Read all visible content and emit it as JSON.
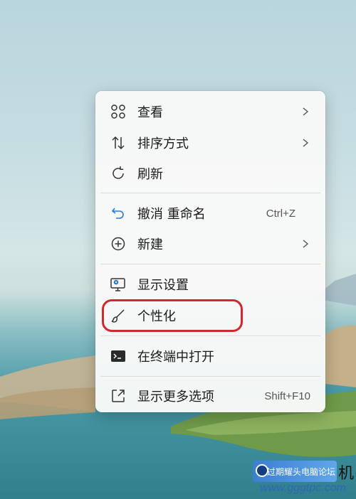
{
  "context_menu": {
    "items": [
      {
        "label": "查看",
        "icon": "grid-icon",
        "submenu": true
      },
      {
        "label": "排序方式",
        "icon": "sort-icon",
        "submenu": true
      },
      {
        "label": "刷新",
        "icon": "refresh-icon"
      },
      {
        "label": "撤消 重命名",
        "icon": "undo-icon",
        "shortcut": "Ctrl+Z"
      },
      {
        "label": "新建",
        "icon": "plus-circle-icon",
        "submenu": true
      },
      {
        "label": "显示设置",
        "icon": "display-settings-icon"
      },
      {
        "label": "个性化",
        "icon": "brush-icon",
        "highlighted": true
      },
      {
        "label": "在终端中打开",
        "icon": "terminal-icon"
      },
      {
        "label": "显示更多选项",
        "icon": "more-options-icon",
        "shortcut": "Shift+F10"
      }
    ]
  },
  "annotation": {
    "color": "#d0282f"
  },
  "watermark": {
    "site_name": "过期耀头电脑论坛",
    "url": "www.gggtpc.com",
    "trailing_char": "机"
  },
  "colors": {
    "accent_icon": "#2b7bd6",
    "menu_bg": "#f8f9f8"
  }
}
